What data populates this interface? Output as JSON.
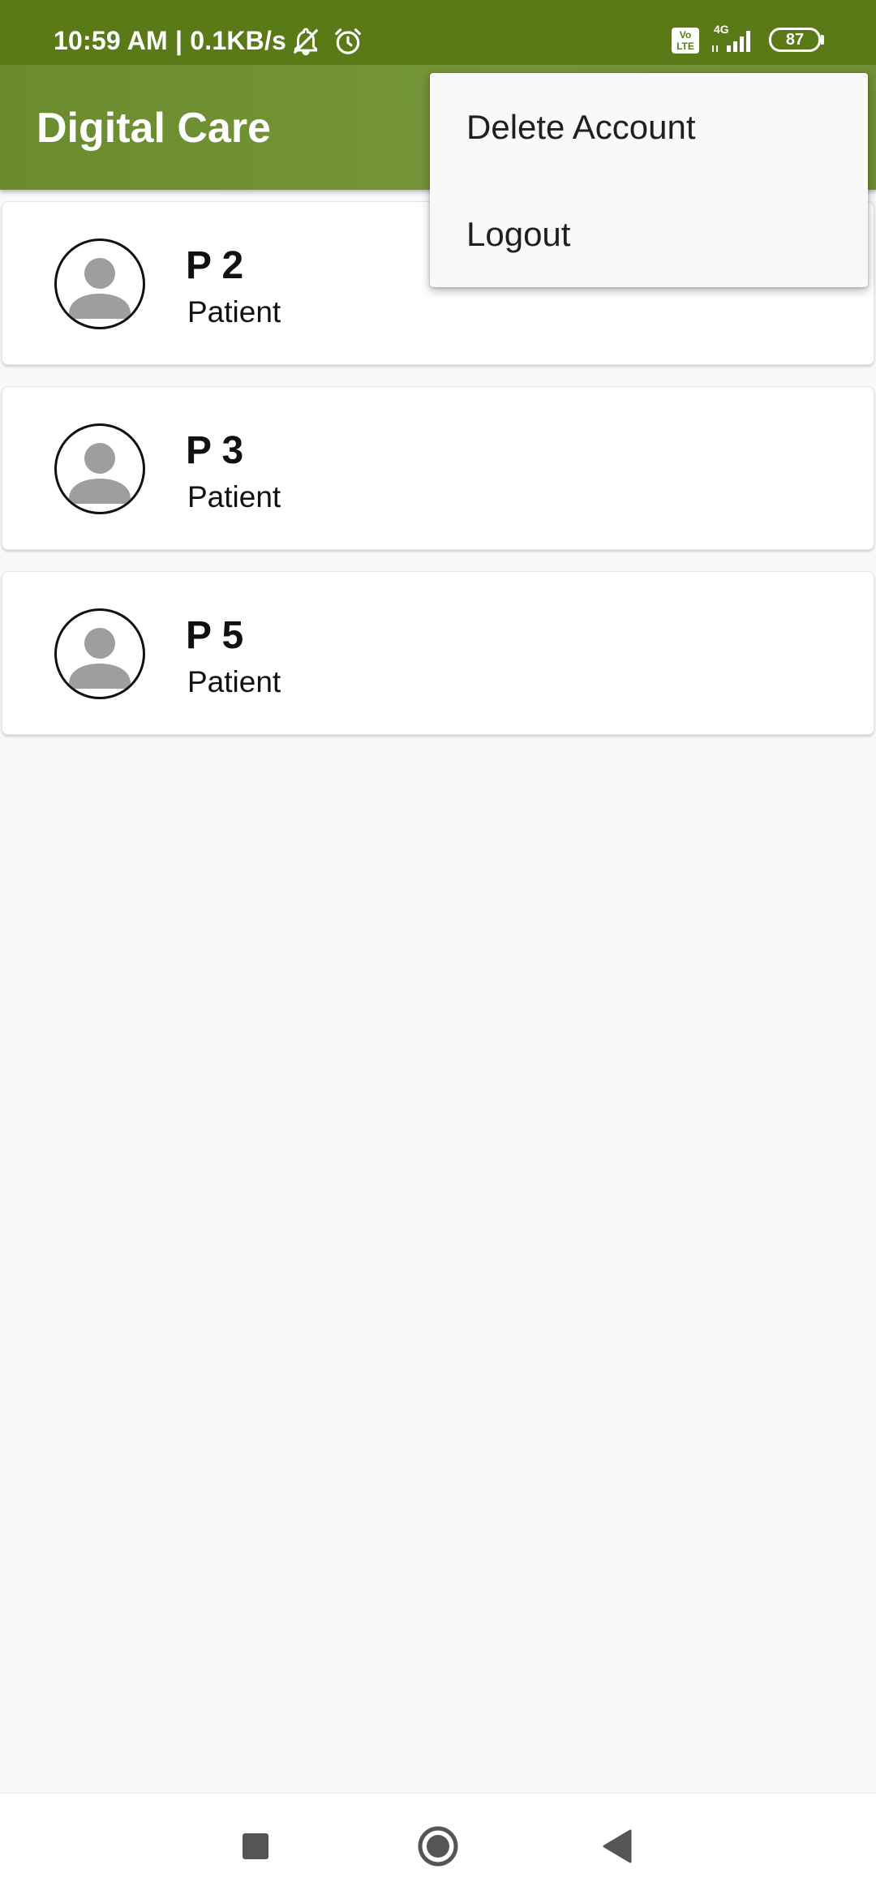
{
  "status_bar": {
    "time": "10:59 AM | 0.1KB/s",
    "network_label": "4G",
    "battery": "87",
    "volte_label": "Vo LTE",
    "icons": [
      "notifications-off-icon",
      "alarm-icon",
      "volte-icon",
      "signal-icon",
      "battery-icon"
    ]
  },
  "app_bar": {
    "title": "Digital Care",
    "color": "#6f9034"
  },
  "patients": [
    {
      "name": "P 2",
      "role": "Patient"
    },
    {
      "name": "P 3",
      "role": "Patient"
    },
    {
      "name": "P 5",
      "role": "Patient"
    }
  ],
  "overflow_menu": {
    "items": [
      {
        "label": "Delete Account"
      },
      {
        "label": "Logout"
      }
    ]
  },
  "nav_bar": {
    "buttons": [
      "recents-icon",
      "home-icon",
      "back-icon"
    ]
  }
}
